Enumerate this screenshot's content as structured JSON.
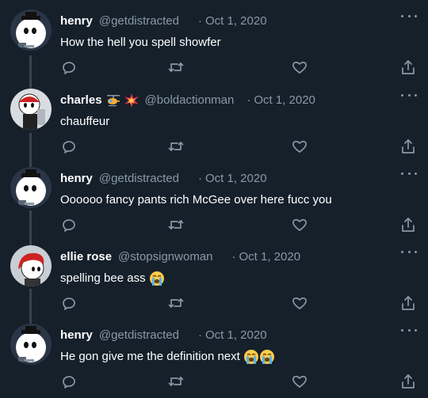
{
  "colors": {
    "background": "#15202b",
    "text_primary": "#ffffff",
    "text_secondary": "#8899a6",
    "thread_line": "#38444d"
  },
  "actions": {
    "reply_icon": "reply-icon",
    "retweet_icon": "retweet-icon",
    "like_icon": "heart-icon",
    "share_icon": "share-icon",
    "more_icon": "more-options-icon"
  },
  "tweets": [
    {
      "display_name": "henry",
      "handle": "@getdistracted",
      "separator": "·",
      "date": "Oct 1, 2020",
      "text": "How the hell you spell showfer",
      "name_emojis": [],
      "text_emojis": []
    },
    {
      "display_name": "charles",
      "handle": "@boldactionman",
      "separator": "·",
      "date": "Oct 1, 2020",
      "text": "chauffeur",
      "name_emojis": [
        "helicopter-emoji",
        "collision-emoji"
      ],
      "text_emojis": []
    },
    {
      "display_name": "henry",
      "handle": "@getdistracted",
      "separator": "·",
      "date": "Oct 1, 2020",
      "text": "Oooooo fancy pants rich McGee over here fucc you",
      "name_emojis": [],
      "text_emojis": []
    },
    {
      "display_name": "ellie rose",
      "handle": "@stopsignwoman",
      "separator": "·",
      "date": "Oct 1, 2020",
      "text": "spelling bee ass",
      "name_emojis": [],
      "text_emojis": [
        "loudly-crying-face-emoji"
      ]
    },
    {
      "display_name": "henry",
      "handle": "@getdistracted",
      "separator": "·",
      "date": "Oct 1, 2020",
      "text": "He gon give me the definition next",
      "name_emojis": [],
      "text_emojis": [
        "loudly-crying-face-emoji",
        "loudly-crying-face-emoji"
      ]
    }
  ]
}
